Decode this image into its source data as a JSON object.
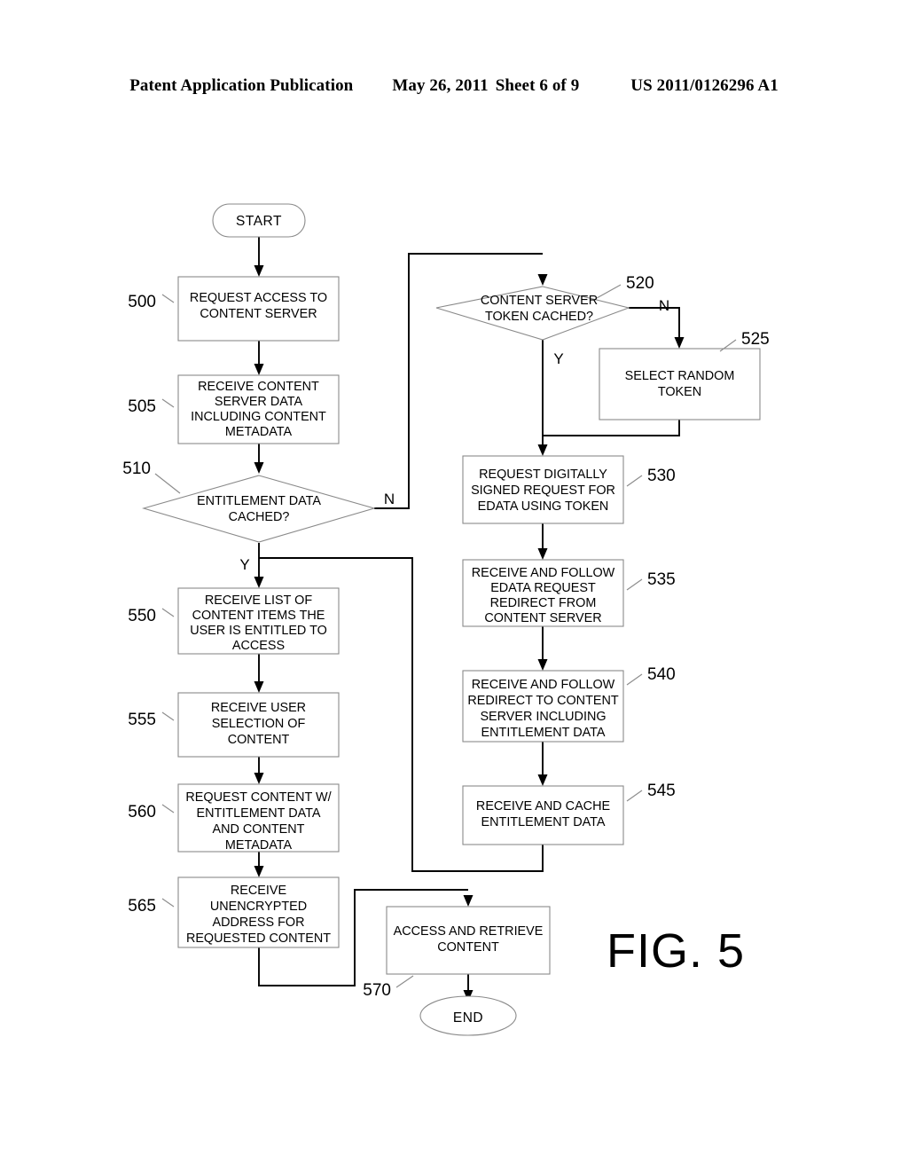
{
  "header": {
    "publication": "Patent Application Publication",
    "date": "May 26, 2011",
    "sheet": "Sheet 6 of 9",
    "patent_number": "US 2011/0126296 A1"
  },
  "figure": {
    "label": "FIG. 5",
    "terminals": {
      "start": "START",
      "end": "END"
    },
    "branch_labels": {
      "yes": "Y",
      "no": "N"
    },
    "nodes": [
      {
        "ref": "500",
        "type": "process",
        "lines": [
          "REQUEST ACCESS TO",
          "CONTENT SERVER"
        ]
      },
      {
        "ref": "505",
        "type": "process",
        "lines": [
          "RECEIVE CONTENT",
          "SERVER DATA",
          "INCLUDING CONTENT",
          "METADATA"
        ]
      },
      {
        "ref": "510",
        "type": "decision",
        "lines": [
          "ENTITLEMENT DATA",
          "CACHED?"
        ]
      },
      {
        "ref": "520",
        "type": "decision",
        "lines": [
          "CONTENT SERVER",
          "TOKEN CACHED?"
        ]
      },
      {
        "ref": "525",
        "type": "process",
        "lines": [
          "SELECT RANDOM",
          "TOKEN"
        ]
      },
      {
        "ref": "530",
        "type": "process",
        "lines": [
          "REQUEST DIGITALLY",
          "SIGNED REQUEST FOR",
          "EDATA USING TOKEN"
        ]
      },
      {
        "ref": "535",
        "type": "process",
        "lines": [
          "RECEIVE AND FOLLOW",
          "EDATA REQUEST",
          "REDIRECT FROM",
          "CONTENT SERVER"
        ]
      },
      {
        "ref": "540",
        "type": "process",
        "lines": [
          "RECEIVE AND FOLLOW",
          "REDIRECT TO CONTENT",
          "SERVER INCLUDING",
          "ENTITLEMENT DATA"
        ]
      },
      {
        "ref": "545",
        "type": "process",
        "lines": [
          "RECEIVE AND CACHE",
          "ENTITLEMENT DATA"
        ]
      },
      {
        "ref": "550",
        "type": "process",
        "lines": [
          "RECEIVE LIST OF",
          "CONTENT ITEMS THE",
          "USER IS ENTITLED TO",
          "ACCESS"
        ]
      },
      {
        "ref": "555",
        "type": "process",
        "lines": [
          "RECEIVE USER",
          "SELECTION OF",
          "CONTENT"
        ]
      },
      {
        "ref": "560",
        "type": "process",
        "lines": [
          "REQUEST CONTENT W/",
          "ENTITLEMENT DATA",
          "AND CONTENT",
          "METADATA"
        ]
      },
      {
        "ref": "565",
        "type": "process",
        "lines": [
          "RECEIVE",
          "UNENCRYPTED",
          "ADDRESS FOR",
          "REQUESTED CONTENT"
        ]
      },
      {
        "ref": "570",
        "type": "process",
        "lines": [
          "ACCESS AND RETRIEVE",
          "CONTENT"
        ]
      }
    ]
  },
  "colors": {
    "ink": "#000000",
    "shape_stroke": "#8a8a8a",
    "paper": "#ffffff"
  }
}
